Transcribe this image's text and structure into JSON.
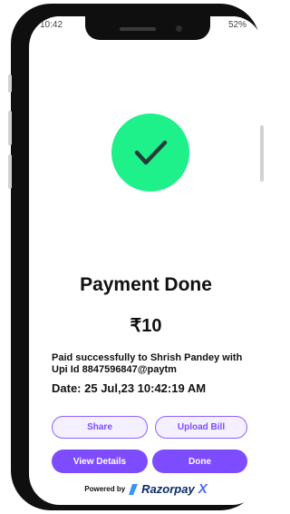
{
  "status_bar": {
    "time": "10:42",
    "battery": "52%"
  },
  "status": {
    "title": "Payment Done",
    "amount": "₹10",
    "paid_line": "Paid successfully to Shrish Pandey with Upi Id 8847596847@paytm",
    "date_line": "Date: 25 Jul,23  10:42:19 AM"
  },
  "actions": {
    "share_label": "Share",
    "upload_label": "Upload Bill",
    "view_label": "View Details",
    "done_label": "Done"
  },
  "footer": {
    "powered_by": "Powered by",
    "brand": "Razorpay",
    "brand_suffix": "X"
  },
  "colors": {
    "accent": "#7d4cff",
    "success": "#1ef08a"
  },
  "icons": [
    "check-icon",
    "razorpay-logo-icon"
  ]
}
